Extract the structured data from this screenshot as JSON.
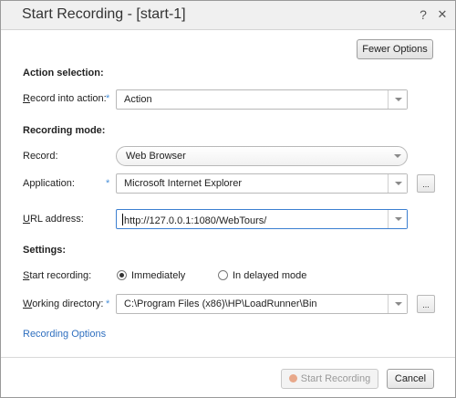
{
  "window": {
    "title": "Start Recording - [start-1]",
    "help_glyph": "?",
    "close_glyph": "✕"
  },
  "toolbar": {
    "fewer_options_label": "Fewer Options"
  },
  "sections": {
    "action_selection": "Action selection:",
    "recording_mode": "Recording mode:",
    "settings": "Settings:"
  },
  "fields": {
    "record_into_action": {
      "label_underlined": "R",
      "label_rest": "ecord into action:",
      "value": "Action"
    },
    "record": {
      "label": "Record:",
      "value": "Web Browser"
    },
    "application": {
      "label": "Application:",
      "value": "Microsoft Internet Explorer"
    },
    "url_address": {
      "label_underlined": "U",
      "label_rest": "RL address:",
      "value": "http://127.0.0.1:1080/WebTours/"
    },
    "start_recording": {
      "label_underlined": "S",
      "label_rest": "tart recording:",
      "options": [
        "Immediately",
        "In delayed mode"
      ],
      "selected": "Immediately"
    },
    "working_directory": {
      "label_underlined": "W",
      "label_rest": "orking directory:",
      "value": "C:\\Program Files (x86)\\HP\\LoadRunner\\Bin"
    }
  },
  "required_marker": "*",
  "browse_glyph": "...",
  "links": {
    "recording_options": "Recording Options"
  },
  "buttons": {
    "start_recording": "Start Recording",
    "cancel": "Cancel"
  },
  "colors": {
    "accent_link": "#2f6fbf",
    "required_star": "#4a90d9",
    "focus_border": "#3c7fd1"
  }
}
